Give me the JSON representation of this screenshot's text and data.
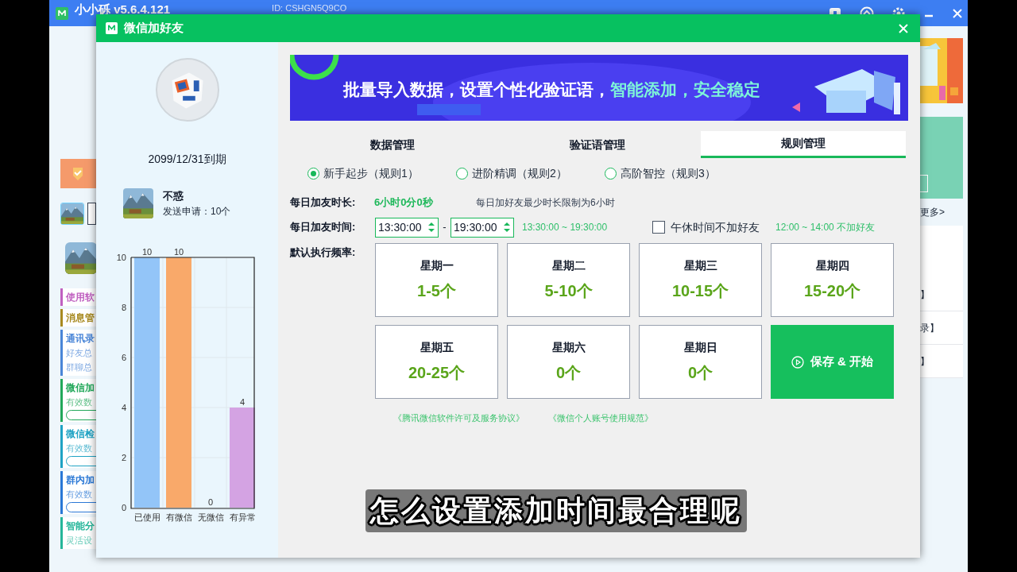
{
  "background_app": {
    "title": "小小砾  v5.6.4.121",
    "id_label": "ID: CSHGN5Q9CO",
    "sidebar_items": [
      {
        "title": "使用软",
        "color": "#c060c0"
      },
      {
        "title": "消息管",
        "color": "#a88a20"
      },
      {
        "title": "通讯录",
        "color": "#4a86d8",
        "lines": [
          "好友总",
          "群聊总"
        ]
      },
      {
        "title": "微信加",
        "color": "#22a85a",
        "lines": [
          "有效数"
        ],
        "pill": true
      },
      {
        "title": "微信检",
        "color": "#1fa3c4",
        "lines": [
          "有效数"
        ],
        "pill": true
      },
      {
        "title": "群内加",
        "color": "#2a78d6",
        "lines": [
          "有效数"
        ],
        "pill": true
      },
      {
        "title": "智能分",
        "color": "#25b69a",
        "lines": [
          "灵活设"
        ]
      }
    ],
    "more_link": "更多>",
    "right_rows": [
      "】",
      "录】",
      "】"
    ]
  },
  "dialog": {
    "title": "微信加好友",
    "expiry": "2099/12/31到期",
    "user": {
      "name": "不惑",
      "sent": "发送申请：10个"
    },
    "chart_data": {
      "type": "bar",
      "categories": [
        "已使用",
        "有微信",
        "无微信",
        "有异常"
      ],
      "values": [
        10,
        10,
        0,
        4
      ],
      "colors": [
        "#93c5f8",
        "#f9a96a",
        null,
        "#d4a3e3"
      ],
      "ylim": [
        0,
        10
      ],
      "yticks": [
        0,
        2,
        4,
        6,
        8,
        10
      ],
      "data_labels": true,
      "grid": true
    },
    "banner": {
      "parts": [
        {
          "text": "批量导入数据，设置个性化验证语，",
          "color": "#ffffff"
        },
        {
          "text": "智能添加，安全稳定",
          "color": "#7ef5d8"
        }
      ]
    },
    "tabs": [
      {
        "label": "数据管理",
        "selected": false
      },
      {
        "label": "验证语管理",
        "selected": false
      },
      {
        "label": "规则管理",
        "selected": true
      }
    ],
    "rules": [
      {
        "label": "新手起步（规则1）",
        "selected": true
      },
      {
        "label": "进阶精调（规则2）",
        "selected": false
      },
      {
        "label": "高阶智控（规则3）",
        "selected": false
      }
    ],
    "duration": {
      "label": "每日加友时长:",
      "value": "6小时0分0秒",
      "note": "每日加好友最少时长限制为6小时"
    },
    "time": {
      "label": "每日加友时间:",
      "start": "13:30:00",
      "separator": "-",
      "end": "19:30:00",
      "range": "13:30:00 ~ 19:30:00",
      "lunch_checked": false,
      "lunch_label": "午休时间不加好友",
      "lunch_note": "12:00 ~ 14:00 不加好友"
    },
    "frequency": {
      "label": "默认执行频率:",
      "days": [
        {
          "day": "星期一",
          "count": "1-5个"
        },
        {
          "day": "星期二",
          "count": "5-10个"
        },
        {
          "day": "星期三",
          "count": "10-15个"
        },
        {
          "day": "星期四",
          "count": "15-20个"
        },
        {
          "day": "星期五",
          "count": "20-25个"
        },
        {
          "day": "星期六",
          "count": "0个"
        },
        {
          "day": "星期日",
          "count": "0个"
        }
      ]
    },
    "start_button": "保存 & 开始",
    "links": [
      "《腾讯微信软件许可及服务协议》",
      "《微信个人账号使用规范》"
    ]
  },
  "subtitle": "怎么设置添加时间最合理呢"
}
